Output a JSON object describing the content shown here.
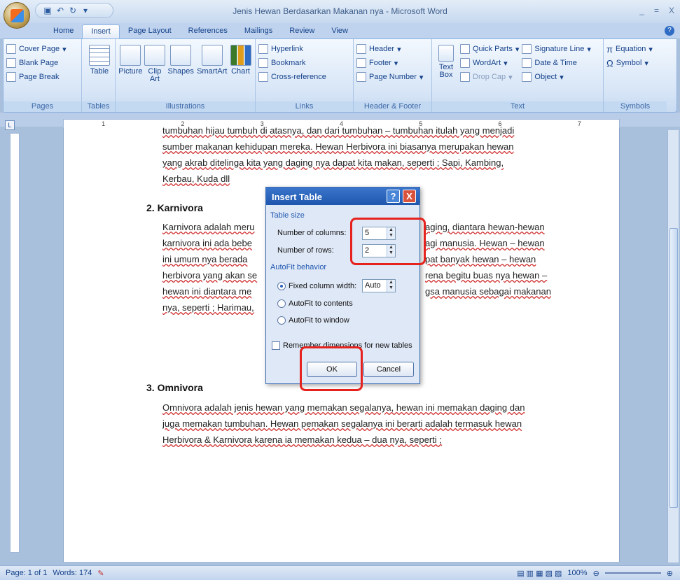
{
  "title_bar": {
    "title": "Jenis Hewan Berdasarkan Makanan nya - Microsoft Word",
    "window_controls": [
      "_",
      "=",
      "X"
    ]
  },
  "ribbon_tabs": [
    "Home",
    "Insert",
    "Page Layout",
    "References",
    "Mailings",
    "Review",
    "View"
  ],
  "active_tab": "Insert",
  "groups": {
    "pages": {
      "label": "Pages",
      "items": [
        "Cover Page",
        "Blank Page",
        "Page Break"
      ]
    },
    "tables": {
      "label": "Tables",
      "items": [
        "Table"
      ]
    },
    "illustrations": {
      "label": "Illustrations",
      "items": [
        "Picture",
        "Clip Art",
        "Shapes",
        "SmartArt",
        "Chart"
      ]
    },
    "links": {
      "label": "Links",
      "items": [
        "Hyperlink",
        "Bookmark",
        "Cross-reference"
      ]
    },
    "header_footer": {
      "label": "Header & Footer",
      "items": [
        "Header",
        "Footer",
        "Page Number"
      ]
    },
    "text": {
      "label": "Text",
      "items": [
        "Text Box",
        "Quick Parts",
        "WordArt",
        "Drop Cap",
        "Signature Line",
        "Date & Time",
        "Object"
      ]
    },
    "symbols": {
      "label": "Symbols",
      "items": [
        "Equation",
        "Symbol"
      ]
    }
  },
  "ruler_marks": [
    "1",
    "2",
    "3",
    "4",
    "5",
    "6",
    "7"
  ],
  "document": {
    "para1": [
      "tumbuhan hijau tumbuh di atasnya, dan dari tumbuhan – tumbuhan itulah yang menjadi",
      "sumber makanan kehidupan mereka. Hewan Herbivora ini biasanya merupakan hewan",
      "yang akrab ditelinga kita yang daging nya dapat kita makan, seperti ; Sapi, Kambing,",
      "Kerbau, Kuda dll"
    ],
    "heading2": "2. Karnivora",
    "para2_left": [
      "Karnivora adalah meru",
      "karnivora ini ada bebe",
      "ini umum nya berada",
      "herbivora yang akan se",
      "hewan ini diantara me",
      "nya, seperti ; Harimau,"
    ],
    "para2_right": [
      "aging, diantara hewan-hewan",
      "agi manusia. Hewan – hewan",
      "pat banyak hewan – hewan",
      "rena begitu buas nya hewan –",
      "gsa manusia sebagai makanan",
      ""
    ],
    "heading3": "3. Omnivora",
    "para3": [
      "Omnivora adalah jenis hewan yang memakan segalanya, hewan ini memakan daging dan",
      "juga memakan tumbuhan. Hewan pemakan segalanya ini berarti adalah termasuk hewan",
      "Herbivora & Karnivora karena ia memakan kedua – dua nya, seperti ;"
    ]
  },
  "dialog": {
    "title": "Insert Table",
    "help": "?",
    "close": "X",
    "table_size": "Table size",
    "cols_label": "Number of columns:",
    "cols_value": "5",
    "rows_label": "Number of rows:",
    "rows_value": "2",
    "autofit": "AutoFit behavior",
    "fixed": "Fixed column width:",
    "fixed_value": "Auto",
    "fit_contents": "AutoFit to contents",
    "fit_window": "AutoFit to window",
    "remember": "Remember dimensions for new tables",
    "ok": "OK",
    "cancel": "Cancel"
  },
  "status": {
    "page": "Page: 1 of 1",
    "words": "Words: 174",
    "zoom": "100%"
  }
}
